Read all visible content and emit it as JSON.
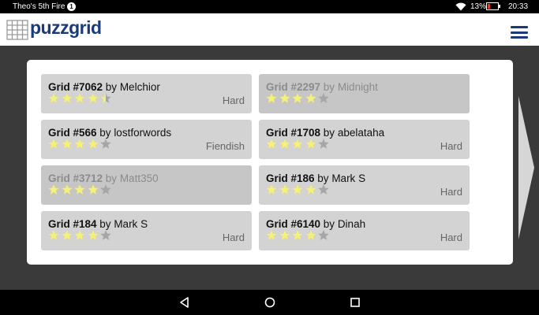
{
  "status_bar": {
    "device_name": "Theo's 5th Fire",
    "notification_count": "1",
    "battery_percent": "13%",
    "time": "20:33",
    "icons": [
      "wifi-icon",
      "battery-low-icon"
    ]
  },
  "app_bar": {
    "logo_text": "puzzgrid",
    "icons": [
      "logo-grid-icon",
      "menu-icon"
    ]
  },
  "colors": {
    "brand": "#1b3a7a",
    "star_filled": "#f5f07a",
    "star_empty": "#a6a6a6",
    "tile": "#d3d3d3"
  },
  "grids": [
    {
      "number": "Grid #7062",
      "by": " by ",
      "author": "Melchior",
      "rating": 4.5,
      "difficulty": "Hard",
      "dimmed": false
    },
    {
      "number": "Grid #2297",
      "by": " by ",
      "author": "Midnight",
      "rating": 4,
      "difficulty": "",
      "dimmed": true
    },
    {
      "number": "Grid #566",
      "by": " by ",
      "author": "lostforwords",
      "rating": 4,
      "difficulty": "Fiendish",
      "dimmed": false
    },
    {
      "number": "Grid #1708",
      "by": " by ",
      "author": "abelataha",
      "rating": 4,
      "difficulty": "Hard",
      "dimmed": false
    },
    {
      "number": "Grid #3712",
      "by": " by ",
      "author": "Matt350",
      "rating": 4,
      "difficulty": "",
      "dimmed": true
    },
    {
      "number": "Grid #186",
      "by": " by ",
      "author": "Mark S",
      "rating": 4,
      "difficulty": "Hard",
      "dimmed": false
    },
    {
      "number": "Grid #184",
      "by": " by ",
      "author": "Mark S",
      "rating": 4,
      "difficulty": "Hard",
      "dimmed": false
    },
    {
      "number": "Grid #6140",
      "by": " by ",
      "author": "Dinah",
      "rating": 4,
      "difficulty": "Hard",
      "dimmed": false
    }
  ],
  "rating_max": 5,
  "pager": {
    "icons": [
      "next-page-arrow-icon"
    ]
  },
  "nav_bar": {
    "icons": [
      "back-icon",
      "home-icon",
      "recents-icon"
    ]
  }
}
